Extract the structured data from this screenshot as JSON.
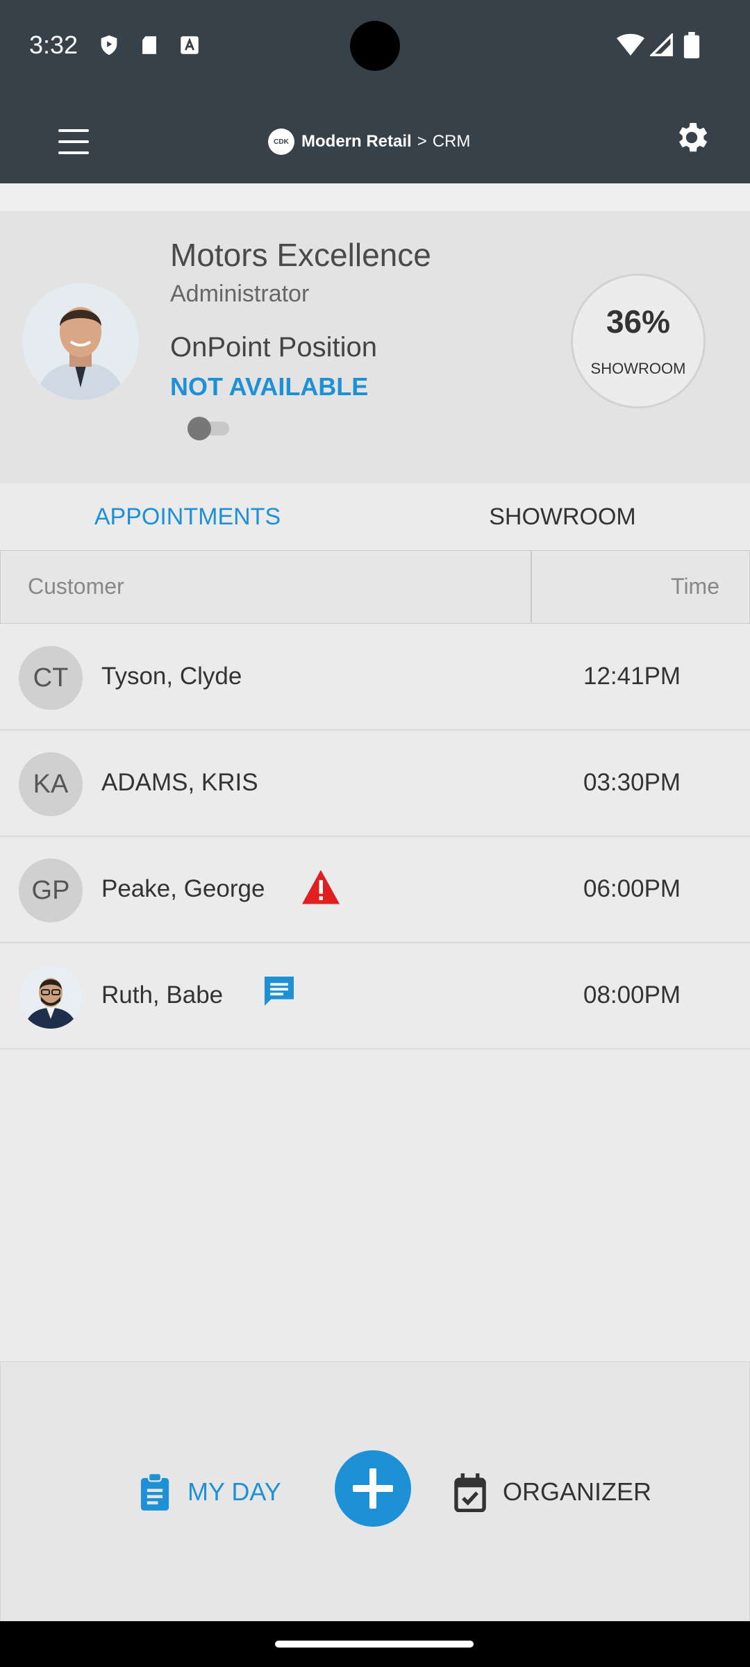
{
  "status_bar": {
    "time": "3:32"
  },
  "header": {
    "brand_logo": "CDK",
    "brand_name": "Modern Retail",
    "separator": ">",
    "section": "CRM"
  },
  "profile": {
    "dealer_name": "Motors Excellence",
    "role": "Administrator",
    "onpoint_label": "OnPoint Position",
    "availability": "NOT AVAILABLE",
    "availability_on": false,
    "gauge": {
      "percent": "36%",
      "value": 36,
      "label": "SHOWROOM"
    }
  },
  "tabs": [
    {
      "label": "APPOINTMENTS",
      "active": true
    },
    {
      "label": "SHOWROOM",
      "active": false
    }
  ],
  "table": {
    "columns": [
      "Customer",
      "Time"
    ],
    "rows": [
      {
        "initials": "CT",
        "name": "Tyson, Clyde",
        "time": "12:41PM",
        "flag": ""
      },
      {
        "initials": "KA",
        "name": "ADAMS, KRIS",
        "time": "03:30PM",
        "flag": ""
      },
      {
        "initials": "GP",
        "name": "Peake, George",
        "time": "06:00PM",
        "flag": "warning-icon"
      },
      {
        "initials": "",
        "name": "Ruth, Babe",
        "time": "08:00PM",
        "flag": "message-icon"
      }
    ]
  },
  "bottom_nav": {
    "my_day": "MY DAY",
    "organizer": "ORGANIZER"
  },
  "colors": {
    "accent": "#1e90d6",
    "header": "#364149",
    "warning": "#e02020"
  }
}
